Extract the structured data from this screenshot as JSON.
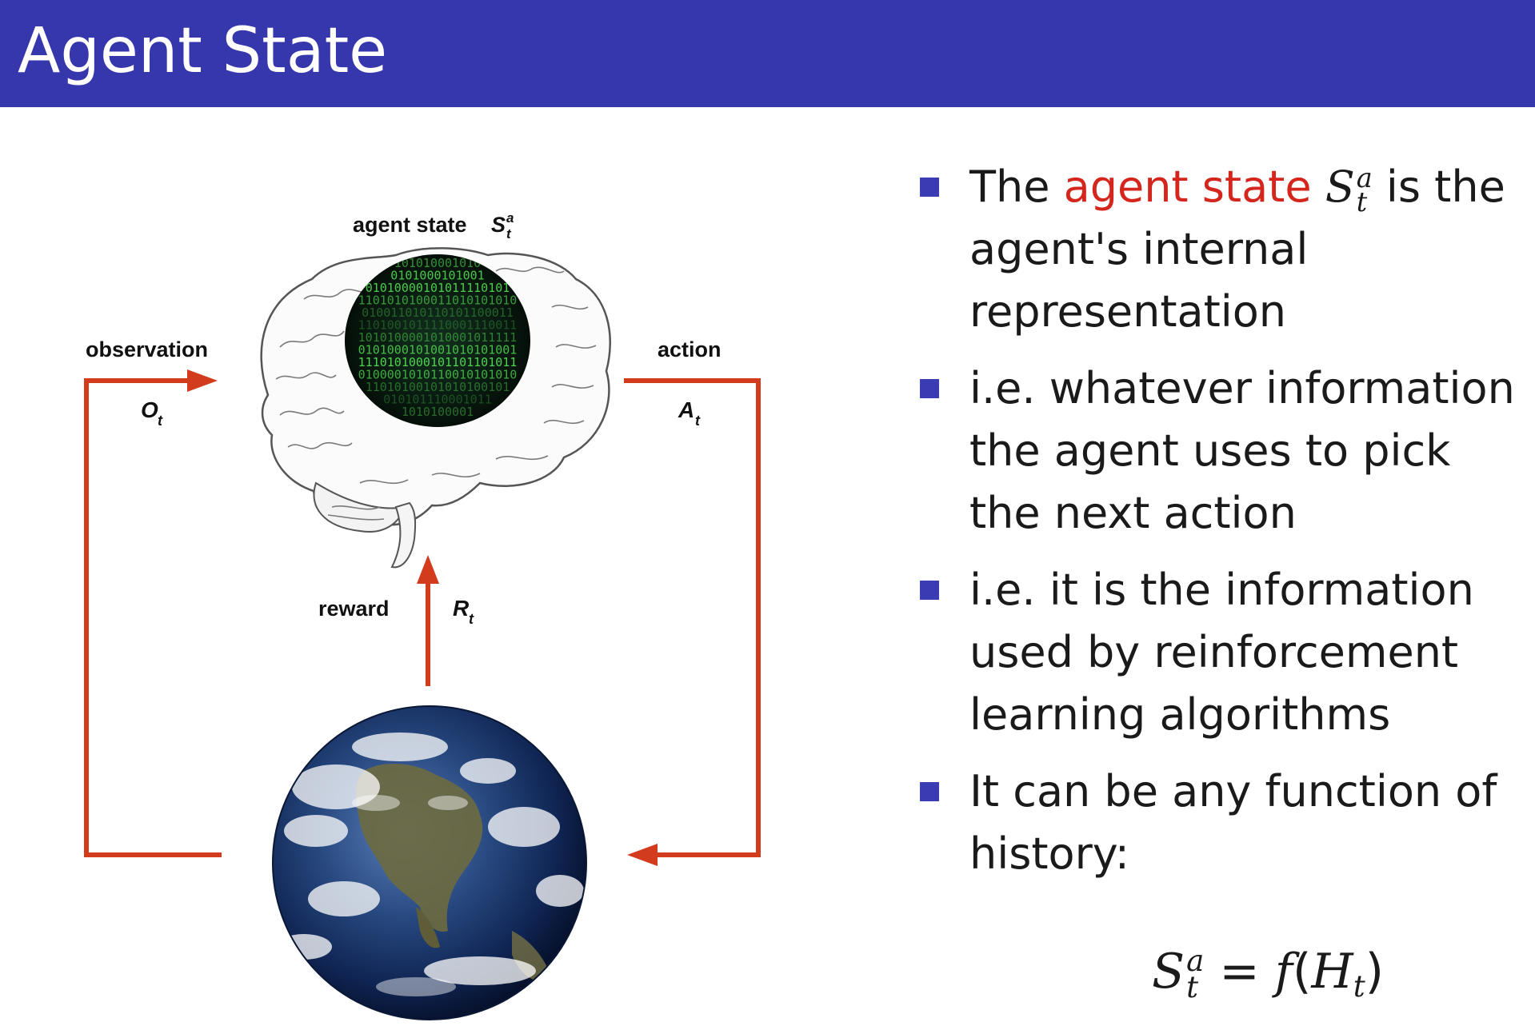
{
  "slide": {
    "title": "Agent State"
  },
  "diagram": {
    "agent_state_label": "agent state",
    "agent_state_symbol": {
      "base": "S",
      "sup": "a",
      "sub": "t"
    },
    "observation_label": "observation",
    "observation_symbol": {
      "base": "O",
      "sub": "t"
    },
    "action_label": "action",
    "action_symbol": {
      "base": "A",
      "sub": "t"
    },
    "reward_label": "reward",
    "reward_symbol": {
      "base": "R",
      "sub": "t"
    },
    "brain_binary_lines": [
      "101010001010",
      "0101000101001",
      "01010000101011110101",
      "1101010100011010101010",
      "010011010110101100011",
      "1101001011110001110011",
      "1010100001010001011111",
      "0101000101001010101001",
      "1110101000101101101011",
      "0100001010110010101010",
      "11010100101010100101",
      "010101110001011",
      "1010100001"
    ],
    "colors": {
      "arrow": "#d23c1c",
      "brain_fill": "#0b1d12",
      "binary_text": "#4fd14f"
    }
  },
  "bullets": {
    "items": [
      {
        "pre": "The ",
        "highlight": "agent state",
        "symbol": {
          "base": "S",
          "sup": "a",
          "sub": "t"
        },
        "post": " is the agent's internal representation"
      },
      {
        "text": "i.e. whatever information the agent uses to pick the next action"
      },
      {
        "text": "i.e. it is the information used by reinforcement learning algorithms"
      },
      {
        "text": "It can be any function of history:"
      }
    ],
    "formula": {
      "lhs_base": "S",
      "lhs_sup": "a",
      "lhs_sub": "t",
      "equals": "=",
      "func": "f",
      "arg_base": "H",
      "arg_sub": "t"
    },
    "marker_color": "#3b3bb3",
    "highlight_color": "#d4261d"
  },
  "theme": {
    "titlebar_color": "#3636ad"
  }
}
